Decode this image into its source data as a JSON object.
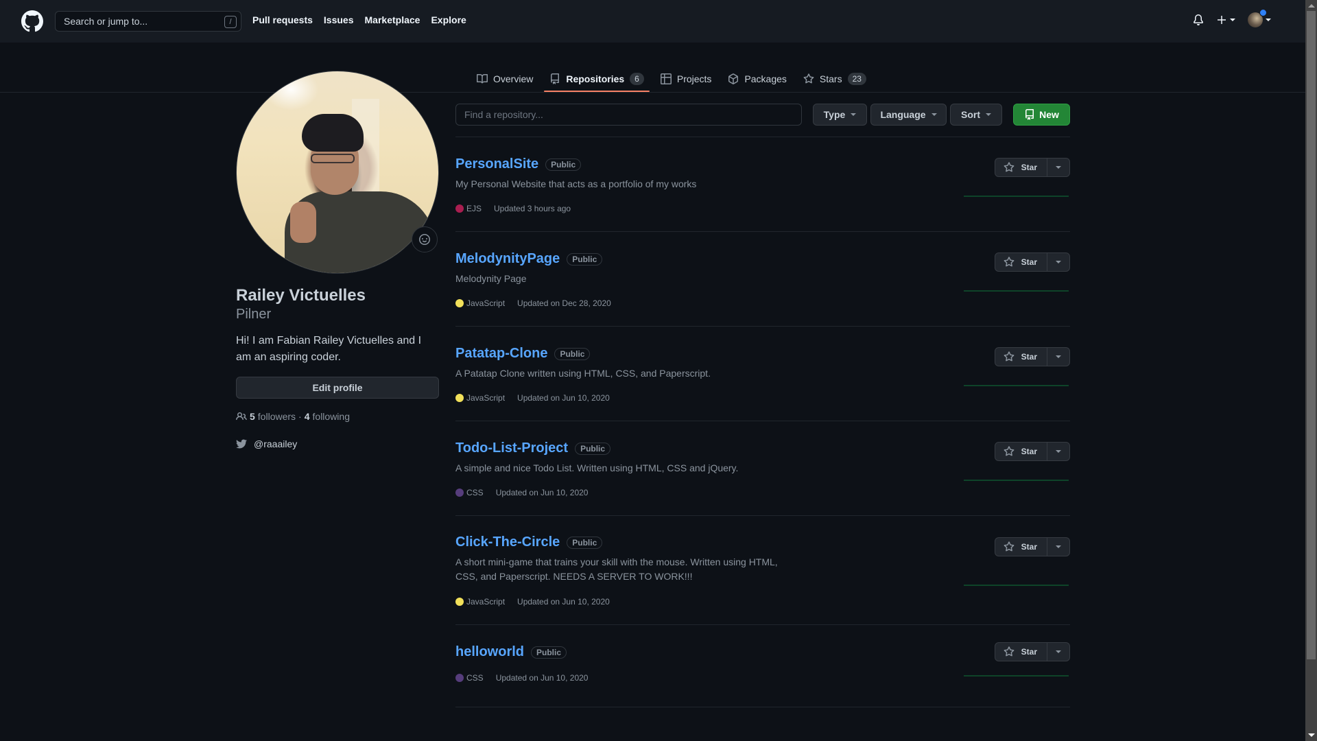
{
  "header": {
    "search_placeholder": "Search or jump to...",
    "search_shortcut": "/",
    "nav": [
      "Pull requests",
      "Issues",
      "Marketplace",
      "Explore"
    ],
    "icons": [
      "github-logo-icon",
      "bell-icon",
      "plus-icon",
      "avatar-menu"
    ]
  },
  "tabs": [
    {
      "label": "Overview",
      "icon": "book-icon",
      "active": false
    },
    {
      "label": "Repositories",
      "icon": "repo-icon",
      "count": "6",
      "active": true
    },
    {
      "label": "Projects",
      "icon": "table-icon",
      "active": false
    },
    {
      "label": "Packages",
      "icon": "package-icon",
      "active": false
    },
    {
      "label": "Stars",
      "icon": "star-icon",
      "count": "23",
      "active": false
    }
  ],
  "profile": {
    "name": "Railey Victuelles",
    "login": "Pilner",
    "bio": "Hi! I am Fabian Railey Victuelles and I am an aspiring coder.",
    "edit_label": "Edit profile",
    "followers_count": "5",
    "followers_label": "followers",
    "separator": "·",
    "following_count": "4",
    "following_label": "following",
    "twitter": "@raaailey"
  },
  "filters": {
    "search_placeholder": "Find a repository...",
    "type_label": "Type",
    "language_label": "Language",
    "sort_label": "Sort",
    "new_label": "New"
  },
  "repos": [
    {
      "name": "PersonalSite",
      "visibility": "Public",
      "description": "My Personal Website that acts as a portfolio of my works",
      "language": "EJS",
      "lang_color": "#a91e50",
      "updated": "Updated 3 hours ago",
      "star_label": "Star"
    },
    {
      "name": "MelodynityPage",
      "visibility": "Public",
      "description": "Melodynity Page",
      "language": "JavaScript",
      "lang_color": "#f1e05a",
      "updated": "Updated on Dec 28, 2020",
      "star_label": "Star"
    },
    {
      "name": "Patatap-Clone",
      "visibility": "Public",
      "description": "A Patatap Clone written using HTML, CSS, and Paperscript.",
      "language": "JavaScript",
      "lang_color": "#f1e05a",
      "updated": "Updated on Jun 10, 2020",
      "star_label": "Star"
    },
    {
      "name": "Todo-List-Project",
      "visibility": "Public",
      "description": "A simple and nice Todo List. Written using HTML, CSS and jQuery.",
      "language": "CSS",
      "lang_color": "#563d7c",
      "updated": "Updated on Jun 10, 2020",
      "star_label": "Star"
    },
    {
      "name": "Click-The-Circle",
      "visibility": "Public",
      "description": "A short mini-game that trains your skill with the mouse. Written using HTML, CSS, and Paperscript. NEEDS A SERVER TO WORK!!!",
      "language": "JavaScript",
      "lang_color": "#f1e05a",
      "updated": "Updated on Jun 10, 2020",
      "star_label": "Star"
    },
    {
      "name": "helloworld",
      "visibility": "Public",
      "description": "",
      "language": "CSS",
      "lang_color": "#563d7c",
      "updated": "Updated on Jun 10, 2020",
      "star_label": "Star"
    }
  ],
  "colors": {
    "accent_link": "#58a6ff",
    "tab_underline": "#f78166",
    "new_button": "#238636",
    "header_bg": "#161b22",
    "page_bg": "#0d1117"
  }
}
